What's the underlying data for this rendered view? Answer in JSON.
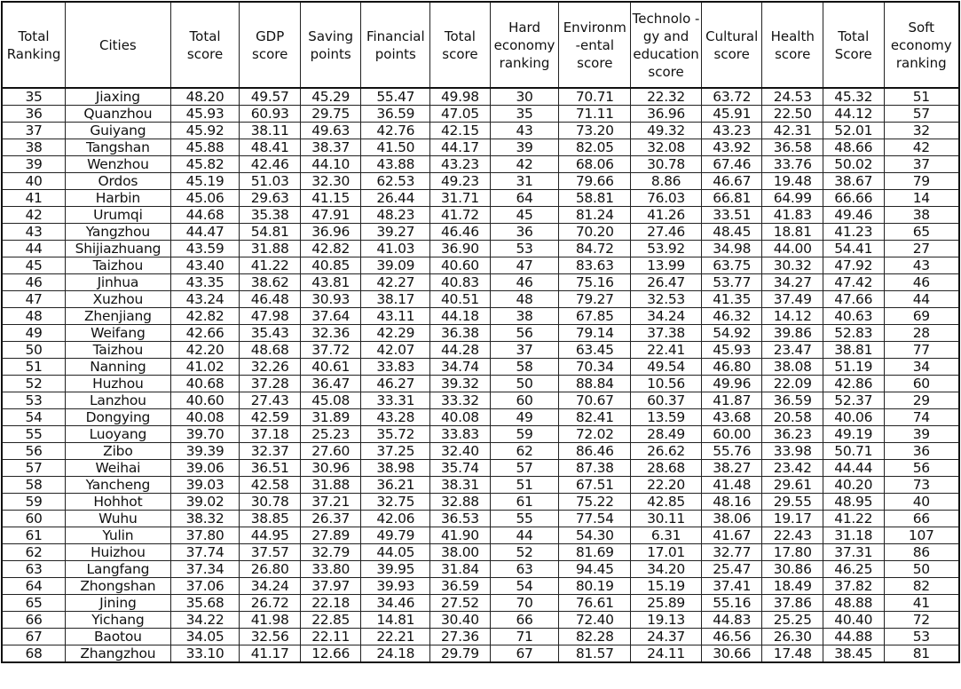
{
  "headers": [
    "Total Ranking",
    "Cities",
    "Total score",
    "GDP score",
    "Saving points",
    "Financial points",
    "Total score",
    "Hard economy ranking",
    "Environm -ental score",
    "Technolo -gy and education score",
    "Cultural score",
    "Health score",
    "Total Score",
    "Soft economy ranking"
  ],
  "rows": [
    [
      "35",
      "Jiaxing",
      "48.20",
      "49.57",
      "45.29",
      "55.47",
      "49.98",
      "30",
      "70.71",
      "22.32",
      "63.72",
      "24.53",
      "45.32",
      "51"
    ],
    [
      "36",
      "Quanzhou",
      "45.93",
      "60.93",
      "29.75",
      "36.59",
      "47.05",
      "35",
      "71.11",
      "36.96",
      "45.91",
      "22.50",
      "44.12",
      "57"
    ],
    [
      "37",
      "Guiyang",
      "45.92",
      "38.11",
      "49.63",
      "42.76",
      "42.15",
      "43",
      "73.20",
      "49.32",
      "43.23",
      "42.31",
      "52.01",
      "32"
    ],
    [
      "38",
      "Tangshan",
      "45.88",
      "48.41",
      "38.37",
      "41.50",
      "44.17",
      "39",
      "82.05",
      "32.08",
      "43.92",
      "36.58",
      "48.66",
      "42"
    ],
    [
      "39",
      "Wenzhou",
      "45.82",
      "42.46",
      "44.10",
      "43.88",
      "43.23",
      "42",
      "68.06",
      "30.78",
      "67.46",
      "33.76",
      "50.02",
      "37"
    ],
    [
      "40",
      "Ordos",
      "45.19",
      "51.03",
      "32.30",
      "62.53",
      "49.23",
      "31",
      "79.66",
      "8.86",
      "46.67",
      "19.48",
      "38.67",
      "79"
    ],
    [
      "41",
      "Harbin",
      "45.06",
      "29.63",
      "41.15",
      "26.44",
      "31.71",
      "64",
      "58.81",
      "76.03",
      "66.81",
      "64.99",
      "66.66",
      "14"
    ],
    [
      "42",
      "Urumqi",
      "44.68",
      "35.38",
      "47.91",
      "48.23",
      "41.72",
      "45",
      "81.24",
      "41.26",
      "33.51",
      "41.83",
      "49.46",
      "38"
    ],
    [
      "43",
      "Yangzhou",
      "44.47",
      "54.81",
      "36.96",
      "39.27",
      "46.46",
      "36",
      "70.20",
      "27.46",
      "48.45",
      "18.81",
      "41.23",
      "65"
    ],
    [
      "44",
      "Shijiazhuang",
      "43.59",
      "31.88",
      "42.82",
      "41.03",
      "36.90",
      "53",
      "84.72",
      "53.92",
      "34.98",
      "44.00",
      "54.41",
      "27"
    ],
    [
      "45",
      "Taizhou",
      "43.40",
      "41.22",
      "40.85",
      "39.09",
      "40.60",
      "47",
      "83.63",
      "13.99",
      "63.75",
      "30.32",
      "47.92",
      "43"
    ],
    [
      "46",
      "Jinhua",
      "43.35",
      "38.62",
      "43.81",
      "42.27",
      "40.83",
      "46",
      "75.16",
      "26.47",
      "53.77",
      "34.27",
      "47.42",
      "46"
    ],
    [
      "47",
      "Xuzhou",
      "43.24",
      "46.48",
      "30.93",
      "38.17",
      "40.51",
      "48",
      "79.27",
      "32.53",
      "41.35",
      "37.49",
      "47.66",
      "44"
    ],
    [
      "48",
      "Zhenjiang",
      "42.82",
      "47.98",
      "37.64",
      "43.11",
      "44.18",
      "38",
      "67.85",
      "34.24",
      "46.32",
      "14.12",
      "40.63",
      "69"
    ],
    [
      "49",
      "Weifang",
      "42.66",
      "35.43",
      "32.36",
      "42.29",
      "36.38",
      "56",
      "79.14",
      "37.38",
      "54.92",
      "39.86",
      "52.83",
      "28"
    ],
    [
      "50",
      "Taizhou",
      "42.20",
      "48.68",
      "37.72",
      "42.07",
      "44.28",
      "37",
      "63.45",
      "22.41",
      "45.93",
      "23.47",
      "38.81",
      "77"
    ],
    [
      "51",
      "Nanning",
      "41.02",
      "32.26",
      "40.61",
      "33.83",
      "34.74",
      "58",
      "70.34",
      "49.54",
      "46.80",
      "38.08",
      "51.19",
      "34"
    ],
    [
      "52",
      "Huzhou",
      "40.68",
      "37.28",
      "36.47",
      "46.27",
      "39.32",
      "50",
      "88.84",
      "10.56",
      "49.96",
      "22.09",
      "42.86",
      "60"
    ],
    [
      "53",
      "Lanzhou",
      "40.60",
      "27.43",
      "45.08",
      "33.31",
      "33.32",
      "60",
      "70.67",
      "60.37",
      "41.87",
      "36.59",
      "52.37",
      "29"
    ],
    [
      "54",
      "Dongying",
      "40.08",
      "42.59",
      "31.89",
      "43.28",
      "40.08",
      "49",
      "82.41",
      "13.59",
      "43.68",
      "20.58",
      "40.06",
      "74"
    ],
    [
      "55",
      "Luoyang",
      "39.70",
      "37.18",
      "25.23",
      "35.72",
      "33.83",
      "59",
      "72.02",
      "28.49",
      "60.00",
      "36.23",
      "49.19",
      "39"
    ],
    [
      "56",
      "Zibo",
      "39.39",
      "32.37",
      "27.60",
      "37.25",
      "32.40",
      "62",
      "86.46",
      "26.62",
      "55.76",
      "33.98",
      "50.71",
      "36"
    ],
    [
      "57",
      "Weihai",
      "39.06",
      "36.51",
      "30.96",
      "38.98",
      "35.74",
      "57",
      "87.38",
      "28.68",
      "38.27",
      "23.42",
      "44.44",
      "56"
    ],
    [
      "58",
      "Yancheng",
      "39.03",
      "42.58",
      "31.88",
      "36.21",
      "38.31",
      "51",
      "67.51",
      "22.20",
      "41.48",
      "29.61",
      "40.20",
      "73"
    ],
    [
      "59",
      "Hohhot",
      "39.02",
      "30.78",
      "37.21",
      "32.75",
      "32.88",
      "61",
      "75.22",
      "42.85",
      "48.16",
      "29.55",
      "48.95",
      "40"
    ],
    [
      "60",
      "Wuhu",
      "38.32",
      "38.85",
      "26.37",
      "42.06",
      "36.53",
      "55",
      "77.54",
      "30.11",
      "38.06",
      "19.17",
      "41.22",
      "66"
    ],
    [
      "61",
      "Yulin",
      "37.80",
      "44.95",
      "27.89",
      "49.79",
      "41.90",
      "44",
      "54.30",
      "6.31",
      "41.67",
      "22.43",
      "31.18",
      "107"
    ],
    [
      "62",
      "Huizhou",
      "37.74",
      "37.57",
      "32.79",
      "44.05",
      "38.00",
      "52",
      "81.69",
      "17.01",
      "32.77",
      "17.80",
      "37.31",
      "86"
    ],
    [
      "63",
      "Langfang",
      "37.34",
      "26.80",
      "33.80",
      "39.95",
      "31.84",
      "63",
      "94.45",
      "34.20",
      "25.47",
      "30.86",
      "46.25",
      "50"
    ],
    [
      "64",
      "Zhongshan",
      "37.06",
      "34.24",
      "37.97",
      "39.93",
      "36.59",
      "54",
      "80.19",
      "15.19",
      "37.41",
      "18.49",
      "37.82",
      "82"
    ],
    [
      "65",
      "Jining",
      "35.68",
      "26.72",
      "22.18",
      "34.46",
      "27.52",
      "70",
      "76.61",
      "25.89",
      "55.16",
      "37.86",
      "48.88",
      "41"
    ],
    [
      "66",
      "Yichang",
      "34.22",
      "41.98",
      "22.85",
      "14.81",
      "30.40",
      "66",
      "72.40",
      "19.13",
      "44.83",
      "25.25",
      "40.40",
      "72"
    ],
    [
      "67",
      "Baotou",
      "34.05",
      "32.56",
      "22.11",
      "22.21",
      "27.36",
      "71",
      "82.28",
      "24.37",
      "46.56",
      "26.30",
      "44.88",
      "53"
    ],
    [
      "68",
      "Zhangzhou",
      "33.10",
      "41.17",
      "12.66",
      "24.18",
      "29.79",
      "67",
      "81.57",
      "24.11",
      "30.66",
      "17.48",
      "38.45",
      "81"
    ]
  ]
}
